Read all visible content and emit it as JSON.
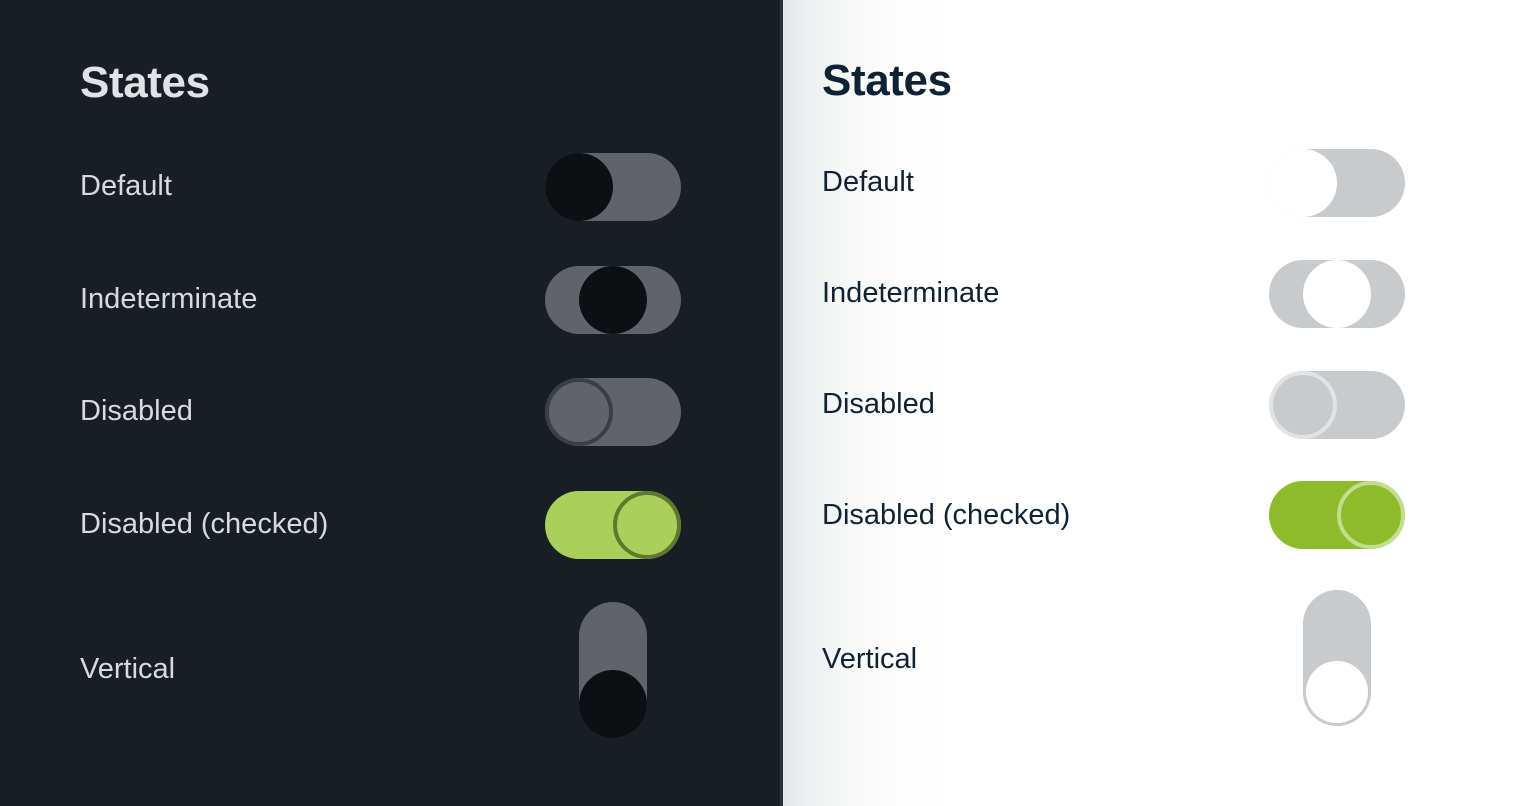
{
  "panels": {
    "dark": {
      "theme_name": "dark",
      "title": "States",
      "background_color": "#191e24",
      "text_color": "#d7dbde",
      "track_color": "#60646a",
      "knob_color": "#0d1013",
      "accent_color": "#a9d159",
      "rows": [
        {
          "label": "Default",
          "state": "default",
          "knob_position": "left",
          "orientation": "horizontal"
        },
        {
          "label": "Indeterminate",
          "state": "indeterminate",
          "knob_position": "center",
          "orientation": "horizontal"
        },
        {
          "label": "Disabled",
          "state": "disabled",
          "knob_position": "left",
          "orientation": "horizontal"
        },
        {
          "label": "Disabled (checked)",
          "state": "disabled-checked",
          "knob_position": "right",
          "orientation": "horizontal"
        },
        {
          "label": "Vertical",
          "state": "vertical",
          "knob_position": "bottom",
          "orientation": "vertical"
        }
      ]
    },
    "light": {
      "theme_name": "light",
      "title": "States",
      "background_color": "#ffffff",
      "text_color": "#0e2234",
      "track_color": "#c9cacc",
      "knob_color": "#ffffff",
      "accent_color": "#8cbb2c",
      "rows": [
        {
          "label": "Default",
          "state": "default",
          "knob_position": "left",
          "orientation": "horizontal"
        },
        {
          "label": "Indeterminate",
          "state": "indeterminate",
          "knob_position": "center",
          "orientation": "horizontal"
        },
        {
          "label": "Disabled",
          "state": "disabled",
          "knob_position": "left",
          "orientation": "horizontal"
        },
        {
          "label": "Disabled (checked)",
          "state": "disabled-checked",
          "knob_position": "right",
          "orientation": "horizontal"
        },
        {
          "label": "Vertical",
          "state": "vertical",
          "knob_position": "bottom",
          "orientation": "vertical"
        }
      ]
    }
  }
}
